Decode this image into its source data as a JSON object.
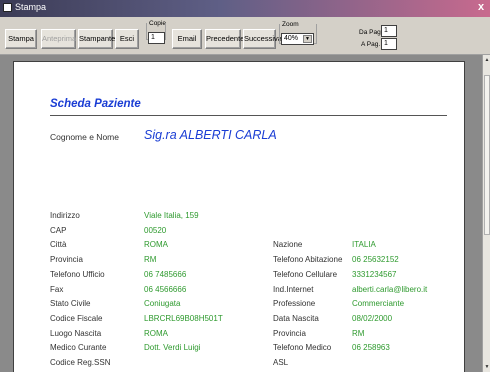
{
  "window": {
    "title": "Stampa",
    "close_glyph": "x"
  },
  "toolbar": {
    "stampa": "Stampa",
    "anteprima": "Anteprima",
    "stampante": "Stampante",
    "esci": "Esci",
    "copie_label": "Copie",
    "copie_value": "1",
    "email": "Email",
    "precedente": "Precedente",
    "successiva": "Successiva",
    "zoom_label": "Zoom",
    "zoom_value": "40%",
    "da_pag_label": "Da Pag.",
    "da_pag_value": "1",
    "a_pag_label": "A Pag.",
    "a_pag_value": "1"
  },
  "report": {
    "section_title": "Scheda Paziente",
    "name_label": "Cognome e Nome",
    "name_value": "Sig.ra ALBERTI CARLA",
    "left_fields": [
      {
        "label": "Indirizzo",
        "value": "Viale Italia, 159"
      },
      {
        "label": "CAP",
        "value": "00520"
      },
      {
        "label": "Città",
        "value": "ROMA"
      },
      {
        "label": "Provincia",
        "value": "RM"
      },
      {
        "label": "Telefono Ufficio",
        "value": "06 7485666"
      },
      {
        "label": "Fax",
        "value": "06 4566666"
      },
      {
        "label": "Stato Civile",
        "value": "Coniugata"
      },
      {
        "label": "Codice Fiscale",
        "value": "LBRCRL69B08H501T"
      },
      {
        "label": "Luogo Nascita",
        "value": "ROMA"
      },
      {
        "label": "Medico Curante",
        "value": "Dott. Verdi Luigi"
      },
      {
        "label": "Codice Reg.SSN",
        "value": ""
      }
    ],
    "right_fields": [
      {
        "label": "Nazione",
        "value": "ITALIA"
      },
      {
        "label": "Telefono Abitazione",
        "value": "06 25632152"
      },
      {
        "label": "Telefono Cellulare",
        "value": "3331234567"
      },
      {
        "label": "Ind.Internet",
        "value": "alberti.carla@libero.it"
      },
      {
        "label": "Professione",
        "value": "Commerciante"
      },
      {
        "label": "Data Nascita",
        "value": "08/02/2000"
      },
      {
        "label": "Provincia",
        "value": "RM"
      },
      {
        "label": "Telefono Medico",
        "value": "06 258963"
      },
      {
        "label": "ASL",
        "value": ""
      }
    ]
  },
  "colors": {
    "title_blue": "#1a3dd4",
    "value_green": "#2e9a2e"
  }
}
